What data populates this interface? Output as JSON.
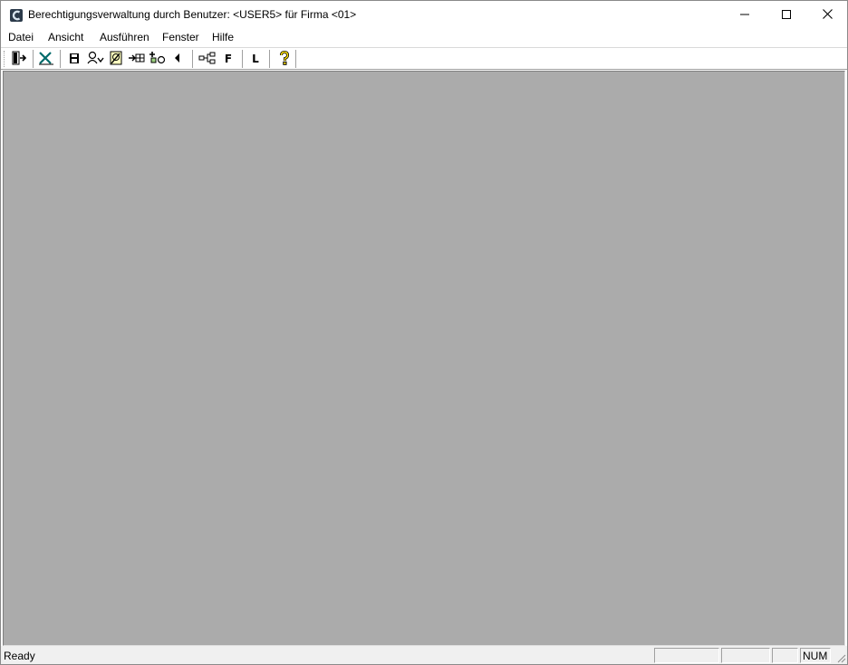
{
  "window": {
    "title": "Berechtigungsverwaltung durch Benutzer: <USER5> für Firma <01>",
    "app_icon": "app-c-icon",
    "controls": {
      "minimize": "minimize-icon",
      "maximize": "maximize-icon",
      "close": "close-icon"
    }
  },
  "menu": {
    "items": [
      {
        "label": "Datei"
      },
      {
        "label": "Ansicht"
      },
      {
        "label": "Ausführen"
      },
      {
        "label": "Fenster"
      },
      {
        "label": "Hilfe"
      }
    ]
  },
  "toolbar": {
    "buttons": [
      {
        "icon": "exit-door-icon"
      },
      {
        "icon": "excel-export-icon"
      },
      {
        "icon": "save-icon"
      },
      {
        "icon": "user-refresh-icon"
      },
      {
        "icon": "edit-document-icon"
      },
      {
        "icon": "arrow-table-icon"
      },
      {
        "icon": "add-shapes-icon"
      },
      {
        "icon": "arrow-left-icon"
      },
      {
        "icon": "tree-structure-icon"
      },
      {
        "label": "F"
      },
      {
        "label": "L"
      },
      {
        "icon": "help-icon"
      }
    ]
  },
  "statusbar": {
    "text": "Ready",
    "indicators": [
      "",
      "",
      "",
      "NUM"
    ]
  },
  "colors": {
    "mdi_background": "#ababab",
    "statusbar_background": "#f0f0f0",
    "window_background": "#ffffff"
  }
}
